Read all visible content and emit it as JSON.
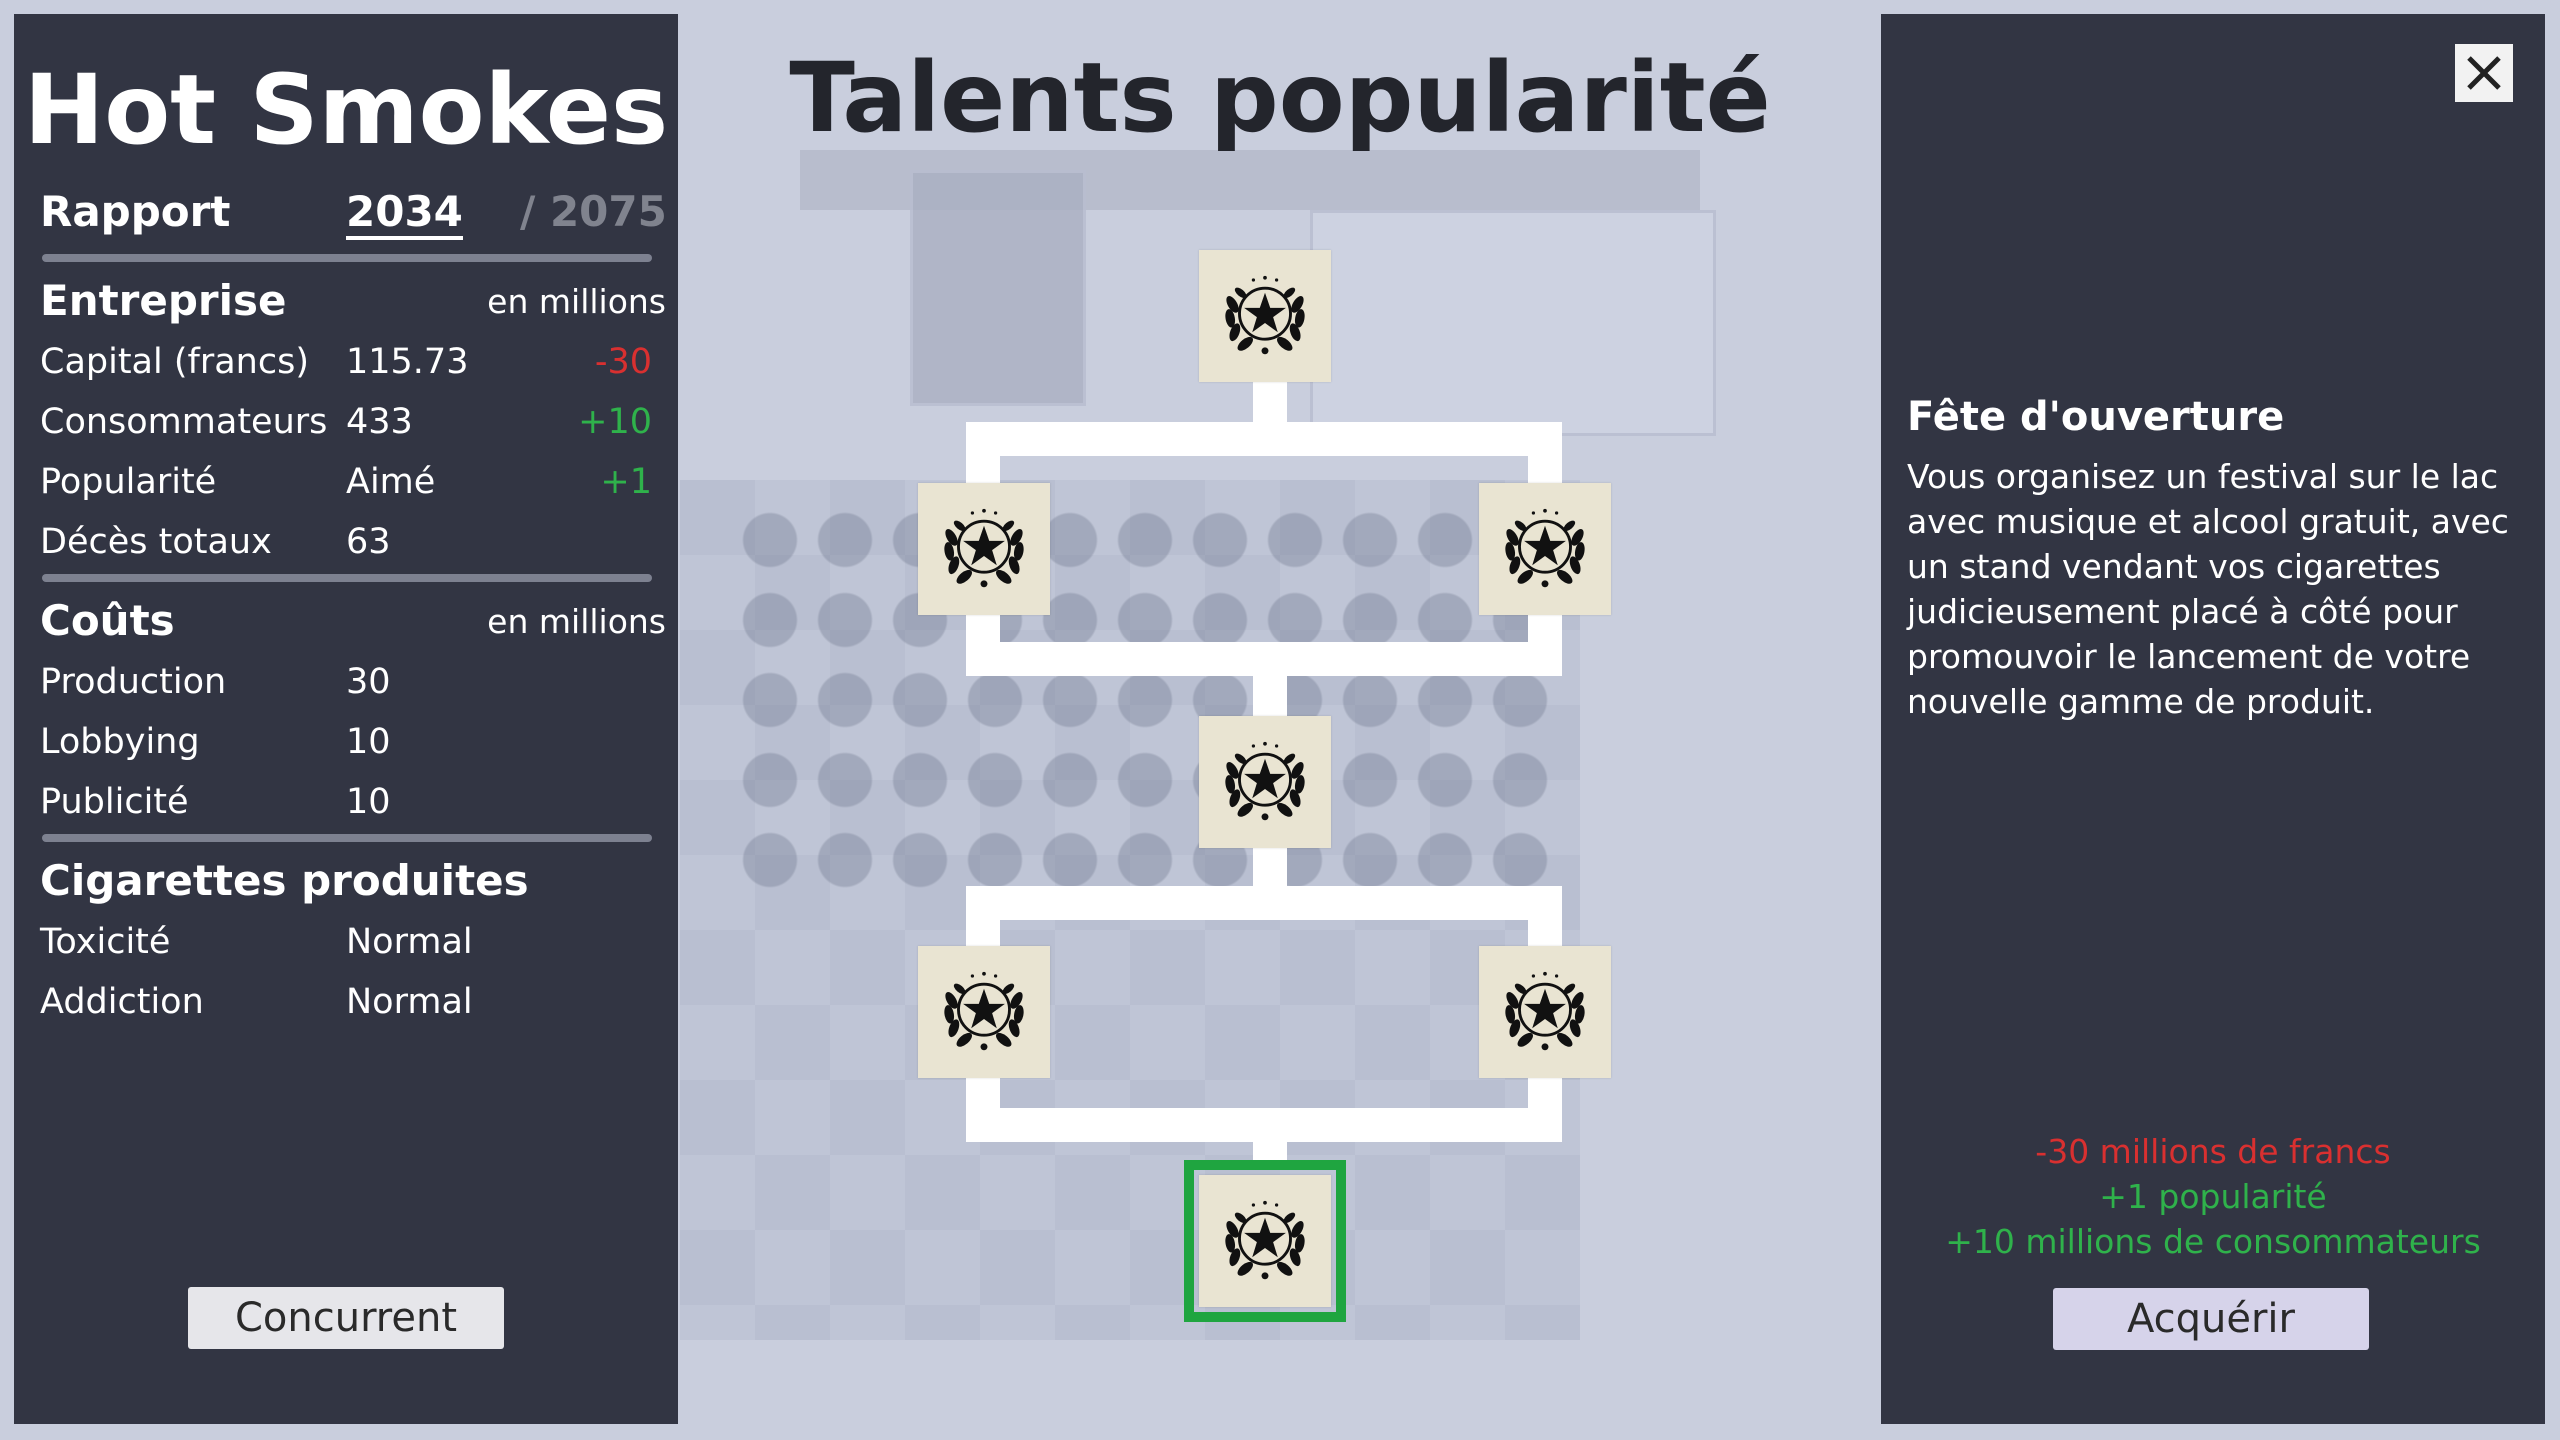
{
  "left_panel": {
    "company_name": "Hot Smokes",
    "report": {
      "label": "Rapport",
      "current_year": "2034",
      "max_year": "/ 2075"
    },
    "enterprise": {
      "title": "Entreprise",
      "unit": "en millions",
      "rows": [
        {
          "label": "Capital (francs)",
          "value": "115.73",
          "delta": "-30"
        },
        {
          "label": "Consommateurs",
          "value": "433",
          "delta": "+10"
        },
        {
          "label": "Popularité",
          "value": "Aimé",
          "delta": "+1"
        },
        {
          "label": "Décès totaux",
          "value": "63",
          "delta": ""
        }
      ]
    },
    "costs": {
      "title": "Coûts",
      "unit": "en millions",
      "rows": [
        {
          "label": "Production",
          "value": "30"
        },
        {
          "label": "Lobbying",
          "value": "10"
        },
        {
          "label": "Publicité",
          "value": "10"
        }
      ]
    },
    "cigarettes": {
      "title": "Cigarettes produites",
      "rows": [
        {
          "label": "Toxicité",
          "value": "Normal"
        },
        {
          "label": "Addiction",
          "value": "Normal"
        }
      ]
    },
    "competitor_button": "Concurrent"
  },
  "page_title": "Talents popularité",
  "talent_tree": {
    "icon": "laurel-star-icon",
    "selected_color": "#1fa540",
    "nodes": [
      "top",
      "left-1",
      "right-1",
      "middle",
      "left-2",
      "right-2",
      "bottom-selected"
    ]
  },
  "right_panel": {
    "close_icon": "close-icon",
    "talent_name": "Fête d'ouverture",
    "description": "Vous organisez un festival sur le lac avec musique et alcool gratuit, avec un stand vendant vos cigarettes judicieusement placé à côté pour promouvoir le lancement de votre nouvelle gamme de produit.",
    "effects": {
      "cost": "-30 millions de francs",
      "popularity": "+1 popularité",
      "consumers": "+10 millions de consommateurs"
    },
    "acquire_button": "Acquérir"
  },
  "colors": {
    "panel": "#323543",
    "negative": "#d93030",
    "positive": "#2fb24b"
  }
}
